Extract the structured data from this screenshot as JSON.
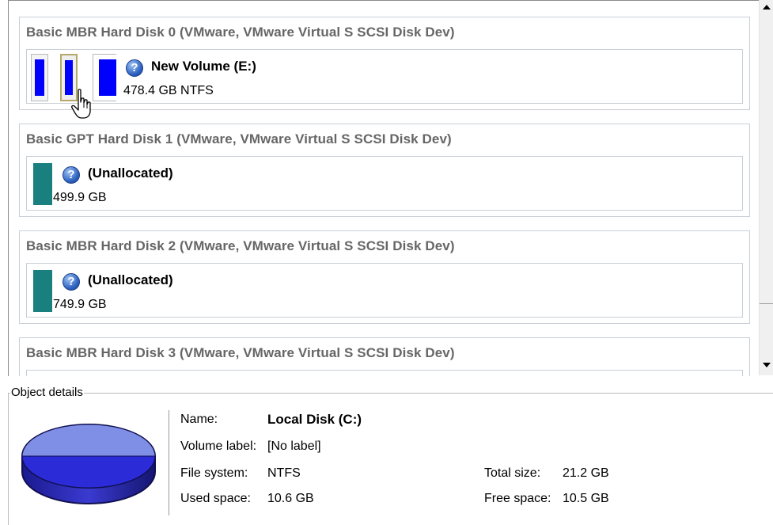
{
  "disks": [
    {
      "title": "Basic MBR Hard Disk 0 (VMware, VMware Virtual S SCSI Disk Dev)",
      "volume_name": "New Volume (E:)",
      "volume_size": "478.4 GB NTFS"
    },
    {
      "title": "Basic GPT Hard Disk 1 (VMware, VMware Virtual S SCSI Disk Dev)",
      "volume_name": "(Unallocated)",
      "volume_size": "499.9 GB"
    },
    {
      "title": "Basic MBR Hard Disk 2 (VMware, VMware Virtual S SCSI Disk Dev)",
      "volume_name": "(Unallocated)",
      "volume_size": "749.9 GB"
    },
    {
      "title": "Basic MBR Hard Disk 3 (VMware, VMware Virtual S SCSI Disk Dev)"
    }
  ],
  "help_glyph": "?",
  "details": {
    "legend": "Object details",
    "name_label": "Name:",
    "name_value": "Local Disk (C:)",
    "volume_label_label": "Volume label:",
    "volume_label_value": "[No label]",
    "file_system_label": "File system:",
    "file_system_value": "NTFS",
    "used_space_label": "Used space:",
    "used_space_value": "10.6 GB",
    "total_size_label": "Total size:",
    "total_size_value": "21.2 GB",
    "free_space_label": "Free space:",
    "free_space_value": "10.5 GB"
  },
  "colors": {
    "partition_blue": "#0000ff",
    "unallocated_teal": "#1a7f7f",
    "title_gray": "#666666"
  }
}
